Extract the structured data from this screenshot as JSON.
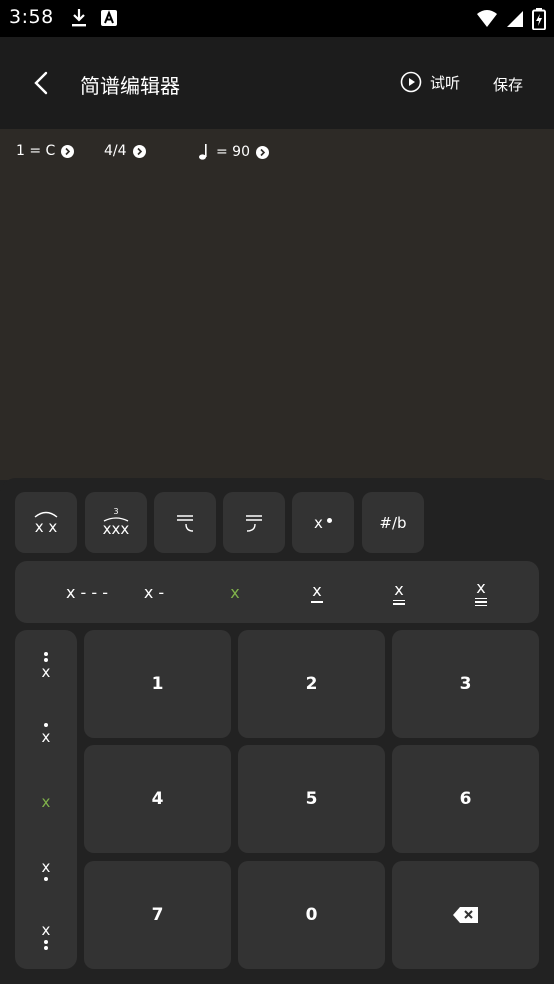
{
  "status_bar": {
    "time": "3:58",
    "icons": [
      "download-icon",
      "keyboard-a-icon",
      "wifi-icon",
      "signal-icon",
      "battery-charging-icon"
    ]
  },
  "app_bar": {
    "title": "简谱编辑器",
    "listen_label": "试听",
    "save_label": "保存"
  },
  "editor": {
    "key": "1 = C",
    "time_signature": "4/4",
    "tempo": "= 90"
  },
  "toolbar": {
    "tie_label": "x x",
    "triplet_top": "3",
    "triplet_label": "xxx",
    "dot_label": "x",
    "accidental_label": "#/b"
  },
  "durations": {
    "whole": "x - - -",
    "half": "x -",
    "quarter": "x",
    "eighth": "x",
    "sixteenth": "x",
    "thirtysecond": "x"
  },
  "octaves": {
    "high2": "x",
    "high1": "x",
    "normal": "x",
    "low1": "x",
    "low2": "x"
  },
  "keys": [
    "1",
    "2",
    "3",
    "4",
    "5",
    "6",
    "7",
    "0"
  ],
  "colors": {
    "accent_active": "#7fb14a",
    "key_bg": "#333333",
    "panel_bg": "#222222",
    "editor_bg": "#2d2a26"
  }
}
